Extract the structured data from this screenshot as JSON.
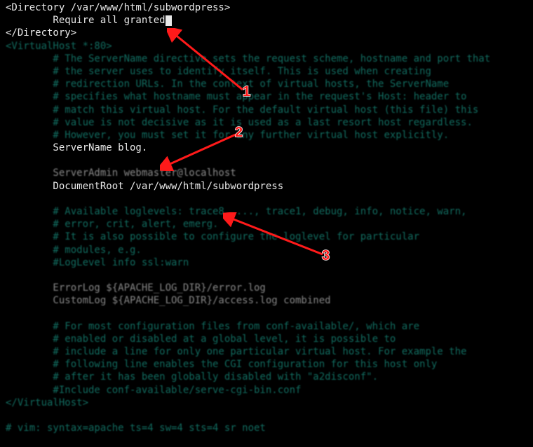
{
  "lines": {
    "l1": "<Directory /var/www/html/subwordpress>",
    "l2": "        Require all granted",
    "l3": "</Directory>",
    "l4": "<VirtualHost *:80>",
    "l5": "        # The ServerName directive sets the request scheme, hostname and port that",
    "l6": "        # the server uses to identify itself. This is used when creating",
    "l7": "        # redirection URLs. In the context of virtual hosts, the ServerName",
    "l8": "        # specifies what hostname must appear in the request's Host: header to",
    "l9": "        # match this virtual host. For the default virtual host (this file) this",
    "l10": "        # value is not decisive as it is used as a last resort host regardless.",
    "l11": "        # However, you must set it for any further virtual host explicitly.",
    "l12": "        ServerName blog.",
    "l13": "",
    "l14": "        ServerAdmin webmaster@localhost",
    "l15": "        DocumentRoot /var/www/html/subwordpress",
    "l16": "",
    "l17": "        # Available loglevels: trace8, ..., trace1, debug, info, notice, warn,",
    "l18": "        # error, crit, alert, emerg.",
    "l19": "        # It is also possible to configure the loglevel for particular",
    "l20": "        # modules, e.g.",
    "l21": "        #LogLevel info ssl:warn",
    "l22": "",
    "l23": "        ErrorLog ${APACHE_LOG_DIR}/error.log",
    "l24": "        CustomLog ${APACHE_LOG_DIR}/access.log combined",
    "l25": "",
    "l26": "        # For most configuration files from conf-available/, which are",
    "l27": "        # enabled or disabled at a global level, it is possible to",
    "l28": "        # include a line for only one particular virtual host. For example the",
    "l29": "        # following line enables the CGI configuration for this host only",
    "l30": "        # after it has been globally disabled with \"a2disconf\".",
    "l31": "        #Include conf-available/serve-cgi-bin.conf",
    "l32": "</VirtualHost>",
    "l33": "",
    "l34": "# vim: syntax=apache ts=4 sw=4 sts=4 sr noet"
  },
  "annotations": {
    "n1": "1",
    "n2": "2",
    "n3": "3"
  }
}
